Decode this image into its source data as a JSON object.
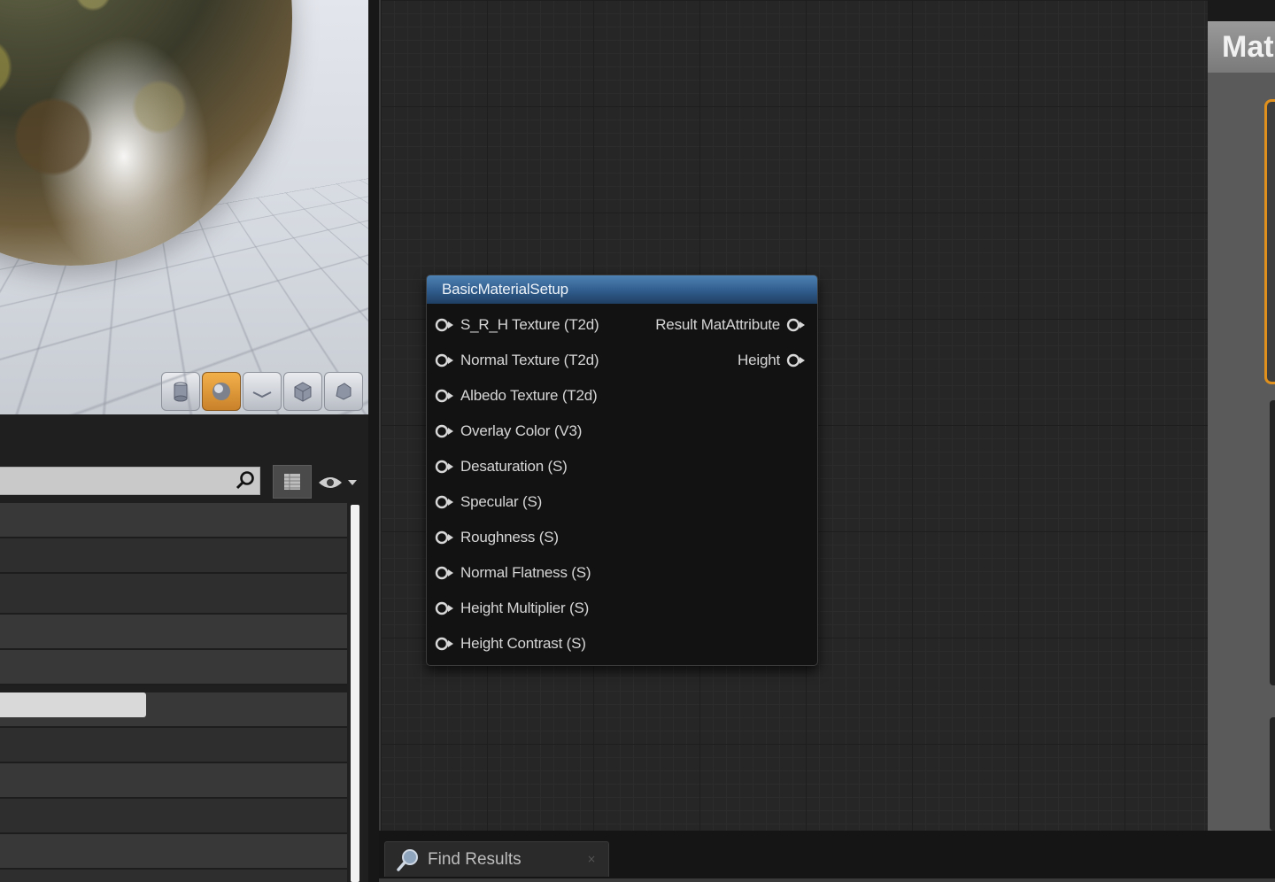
{
  "viewport": {
    "toolbar_buttons": [
      "cylinder-icon",
      "sphere-icon",
      "plane-icon",
      "cube-icon",
      "custom-mesh-icon"
    ],
    "active_button": "sphere-icon",
    "active_color": "#e0901c"
  },
  "search": {
    "placeholder": "",
    "value": ""
  },
  "graph": {
    "node": {
      "title": "BasicMaterialSetup",
      "inputs": [
        "S_R_H Texture (T2d)",
        "Normal Texture (T2d)",
        "Albedo Texture (T2d)",
        "Overlay Color (V3)",
        "Desaturation (S)",
        "Specular (S)",
        "Roughness (S)",
        "Normal Flatness (S)",
        "Height Multiplier (S)",
        "Height Contrast (S)"
      ],
      "outputs": [
        "Result MatAttribute",
        "Height"
      ]
    }
  },
  "right_panel": {
    "title": "Mat"
  },
  "bottom": {
    "tab_label": "Find Results",
    "tab_close": "×"
  }
}
